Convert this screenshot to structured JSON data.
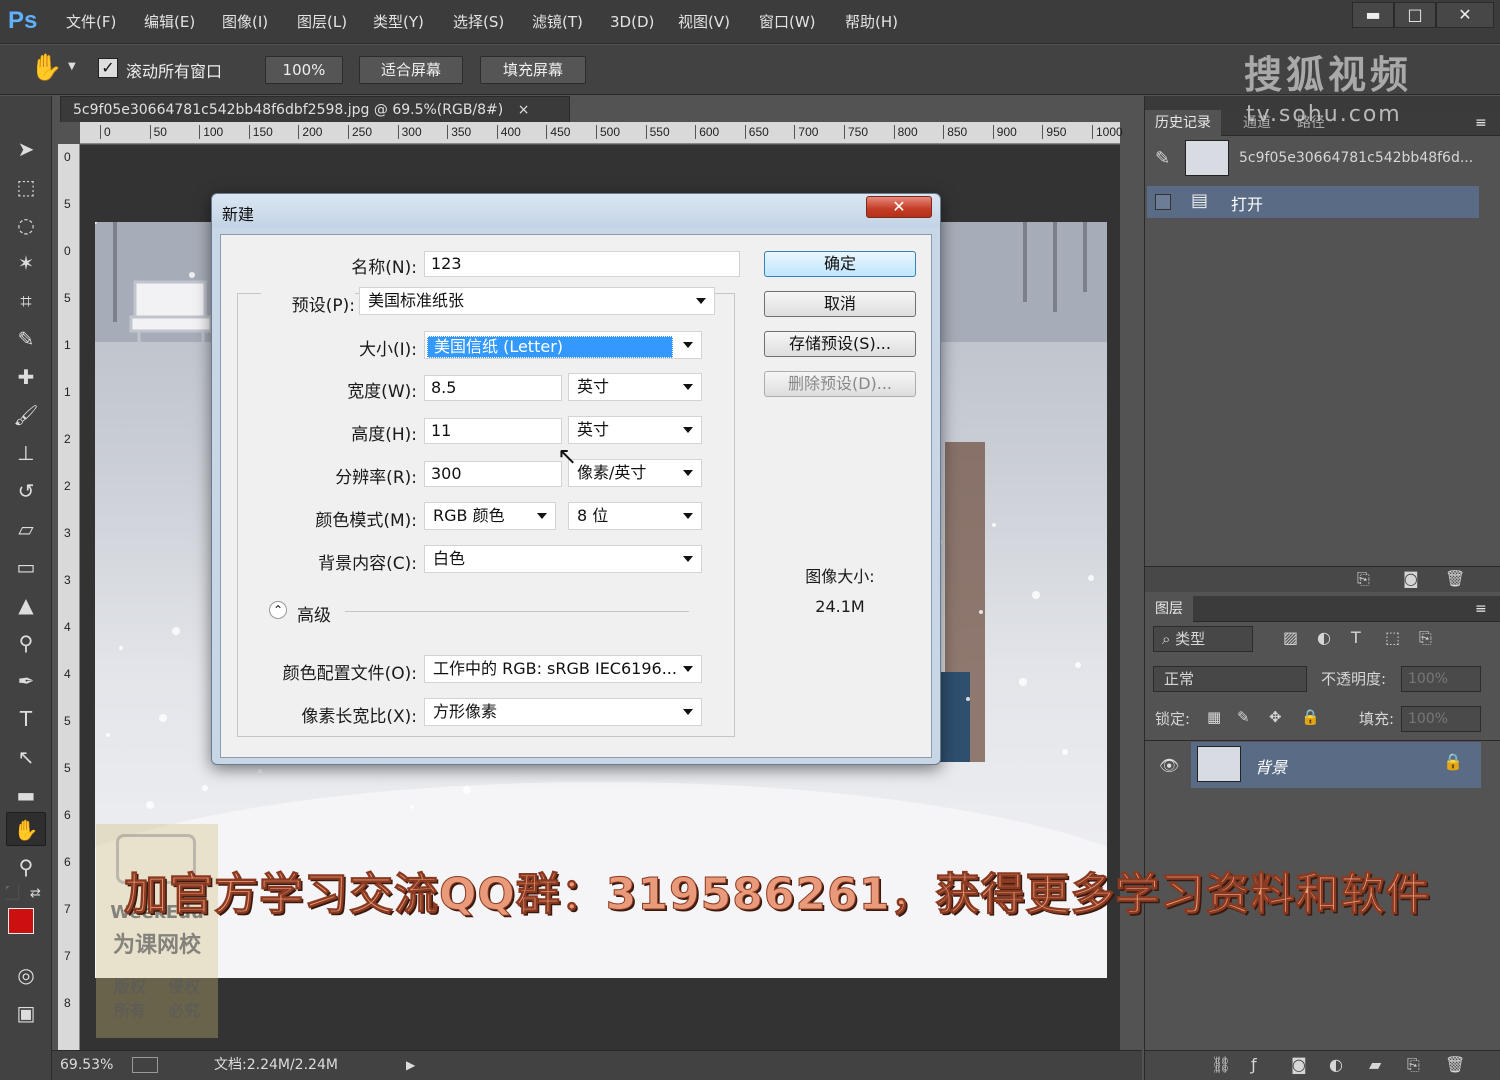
{
  "app": {
    "logo": "Ps",
    "menu": [
      "文件(F)",
      "编辑(E)",
      "图像(I)",
      "图层(L)",
      "类型(Y)",
      "选择(S)",
      "滤镜(T)",
      "3D(D)",
      "视图(V)",
      "窗口(W)",
      "帮助(H)"
    ],
    "window_controls": {
      "minimize": "▬",
      "maximize": "□",
      "close": "✕"
    }
  },
  "options": {
    "scroll_all_label": "滚动所有窗口",
    "scroll_all_checked": true,
    "zoom_100": "100%",
    "fit_screen": "适合屏幕",
    "fill_screen": "填充屏幕"
  },
  "watermark": {
    "sohu": "搜狐视频",
    "sohu_url": "tv.sohu.com"
  },
  "document": {
    "tab_title": "5c9f05e30664781c542bb48f6dbf2598.jpg @ 69.5%(RGB/8#)",
    "tab_close": "×",
    "ruler_h": [
      "0",
      "50",
      "100",
      "150",
      "200",
      "250",
      "300",
      "350",
      "400",
      "450",
      "500",
      "550",
      "600",
      "650",
      "700",
      "750",
      "800",
      "850",
      "900",
      "950",
      "1000"
    ],
    "ruler_v": [
      "0",
      "5",
      "0",
      "5",
      "1",
      "1",
      "2",
      "2",
      "3",
      "3",
      "4",
      "4",
      "5",
      "5",
      "6",
      "6",
      "7",
      "7",
      "8"
    ],
    "zoom_status": "69.53%",
    "doc_status": "文档:2.24M/2.24M"
  },
  "dialog": {
    "title": "新建",
    "close": "✕",
    "name_label": "名称(N):",
    "name_value": "123",
    "preset_label": "预设(P):",
    "preset_value": "美国标准纸张",
    "size_label": "大小(I):",
    "size_value": "美国信纸 (Letter)",
    "width_label": "宽度(W):",
    "width_value": "8.5",
    "width_unit": "英寸",
    "height_label": "高度(H):",
    "height_value": "11",
    "height_unit": "英寸",
    "resolution_label": "分辨率(R):",
    "resolution_value": "300",
    "resolution_unit": "像素/英寸",
    "color_mode_label": "颜色模式(M):",
    "color_mode_value": "RGB 颜色",
    "bit_depth_value": "8 位",
    "bg_label": "背景内容(C):",
    "bg_value": "白色",
    "advanced_label": "高级",
    "advanced_icon": "⌃",
    "profile_label": "颜色配置文件(O):",
    "profile_value": "工作中的 RGB: sRGB IEC6196...",
    "aspect_label": "像素长宽比(X):",
    "aspect_value": "方形像素",
    "ok": "确定",
    "cancel": "取消",
    "save_preset": "存储预设(S)...",
    "delete_preset": "删除预设(D)...",
    "image_size_label": "图像大小:",
    "image_size_value": "24.1M"
  },
  "history_panel": {
    "tabs": [
      "历史记录",
      "通道",
      "路径"
    ],
    "snapshot_name": "5c9f05e30664781c542bb48f6d...",
    "items": [
      "打开"
    ]
  },
  "layers_panel": {
    "title": "图层",
    "filter_kind": "类型",
    "blend_mode": "正常",
    "opacity_label": "不透明度:",
    "opacity_value": "100%",
    "lock_label": "锁定:",
    "fill_label": "填充:",
    "fill_value": "100%",
    "layers": [
      {
        "name": "背景",
        "visible": true,
        "locked": true
      }
    ]
  },
  "overlay": {
    "banner": "加官方学习交流QQ群：319586261，获得更多学习资料和软件",
    "weekedu_title": "WeekEdu",
    "weekedu_cn": "为课网校",
    "weekedu_notes": [
      "版权",
      "侵权",
      "所有",
      "必究"
    ]
  },
  "colors": {
    "foreground": "#cc1010",
    "background": "#ffffff",
    "accent_blue": "#5fb1ff"
  }
}
